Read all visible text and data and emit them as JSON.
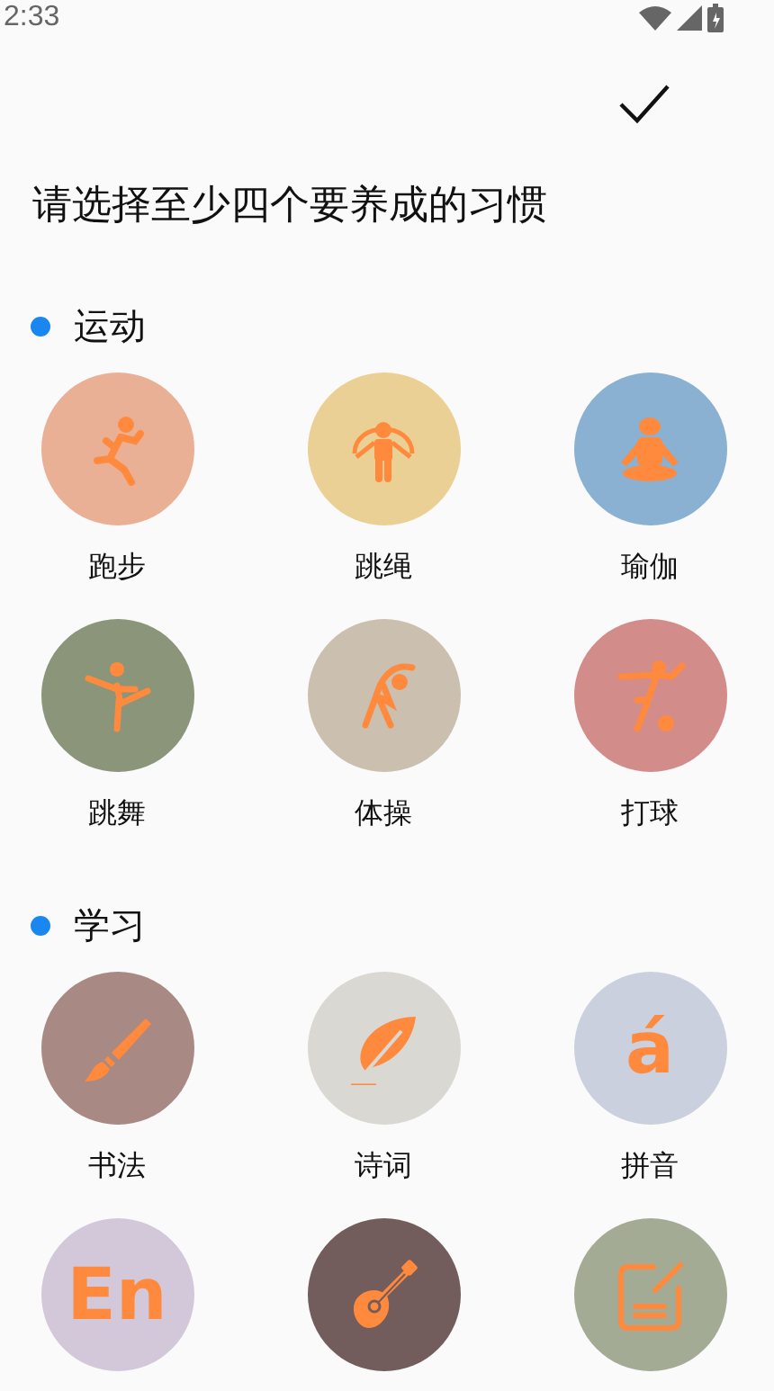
{
  "status_bar": {
    "time": "2:33"
  },
  "title": "请选择至少四个要养成的习惯",
  "sections": [
    {
      "name": "运动",
      "color": "#1a86f0",
      "items": [
        {
          "kind": "icon",
          "label": "跑步",
          "color": "#e9b096"
        },
        {
          "kind": "icon",
          "label": "跳绳",
          "color": "#ead095"
        },
        {
          "kind": "icon",
          "label": "瑜伽",
          "color": "#8ab1d2"
        },
        {
          "kind": "icon",
          "label": "跳舞",
          "color": "#8a957a"
        },
        {
          "kind": "icon",
          "label": "体操",
          "color": "#cbbfaf"
        },
        {
          "kind": "icon",
          "label": "打球",
          "color": "#d28c8a"
        }
      ]
    },
    {
      "name": "学习",
      "color": "#1a86f0",
      "items": [
        {
          "kind": "icon",
          "label": "书法",
          "color": "#a88984"
        },
        {
          "kind": "icon",
          "label": "诗词",
          "color": "#dad8d3"
        },
        {
          "kind": "glyph",
          "glyph": "á",
          "label": "拼音",
          "color": "#cad0de"
        },
        {
          "kind": "glyph",
          "glyph": "En",
          "color": "#d2c8da"
        },
        {
          "kind": "icon",
          "color": "#735c5c"
        },
        {
          "kind": "icon",
          "color": "#a4ab95"
        }
      ]
    }
  ]
}
